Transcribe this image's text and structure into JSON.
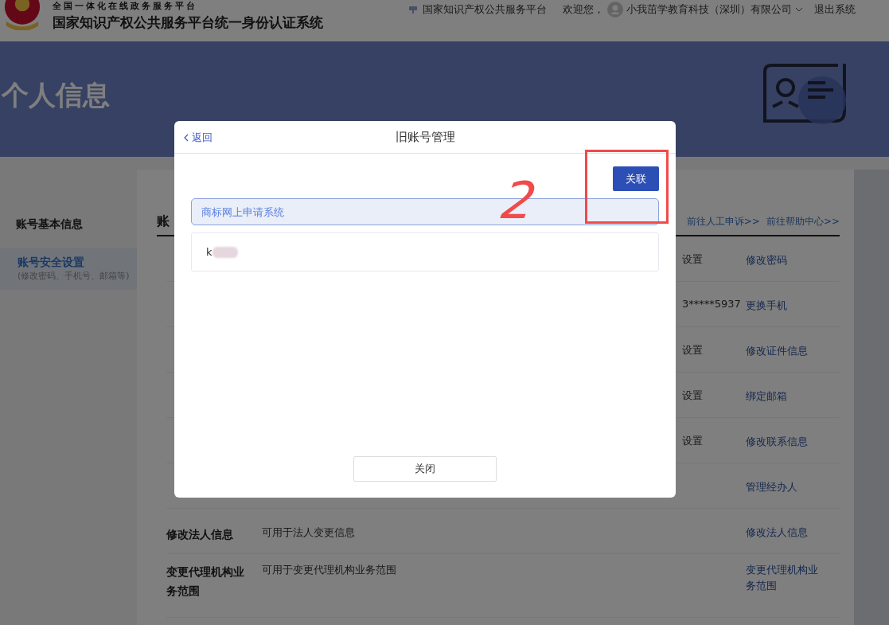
{
  "header": {
    "portal_line": "全国一体化在线政务服务平台",
    "system_title": "国家知识产权公共服务平台统一身份认证系统",
    "platform_link": "国家知识产权公共服务平台",
    "welcome": "欢迎您，",
    "user": "小我茁学教育科技（深圳）有限公司",
    "logout": "退出系统"
  },
  "banner": {
    "title": "个人信息"
  },
  "sidebar": {
    "items": [
      {
        "label": "账号基本信息",
        "selected": false
      },
      {
        "label": "账号安全设置",
        "hint": "(修改密码、手机号、邮箱等)",
        "selected": true
      }
    ]
  },
  "content": {
    "tab": "账",
    "links": [
      "前往人工申诉>>",
      "前往帮助中心>>"
    ],
    "rows": [
      {
        "status": "设置",
        "action": "修改密码"
      },
      {
        "status": "3*****5937",
        "action": "更换手机"
      },
      {
        "status": "设置",
        "action": "修改证件信息"
      },
      {
        "status": "设置",
        "action": "绑定邮箱"
      },
      {
        "status": "设置",
        "action": "修改联系信息"
      },
      {
        "action": "管理经办人"
      },
      {
        "label": "修改法人信息",
        "description": "可用于法人变更信息",
        "action": "修改法人信息"
      },
      {
        "label": "变更代理机构业务范围",
        "description": "可用于变更代理机构业务范围",
        "action": "变更代理机构业务范围"
      }
    ]
  },
  "dialog": {
    "back": "返回",
    "title": "旧账号管理",
    "link_button": "关联",
    "system": "商标网上申请系统",
    "account": "k",
    "close": "关闭"
  },
  "annotation": {
    "mark": "2"
  }
}
